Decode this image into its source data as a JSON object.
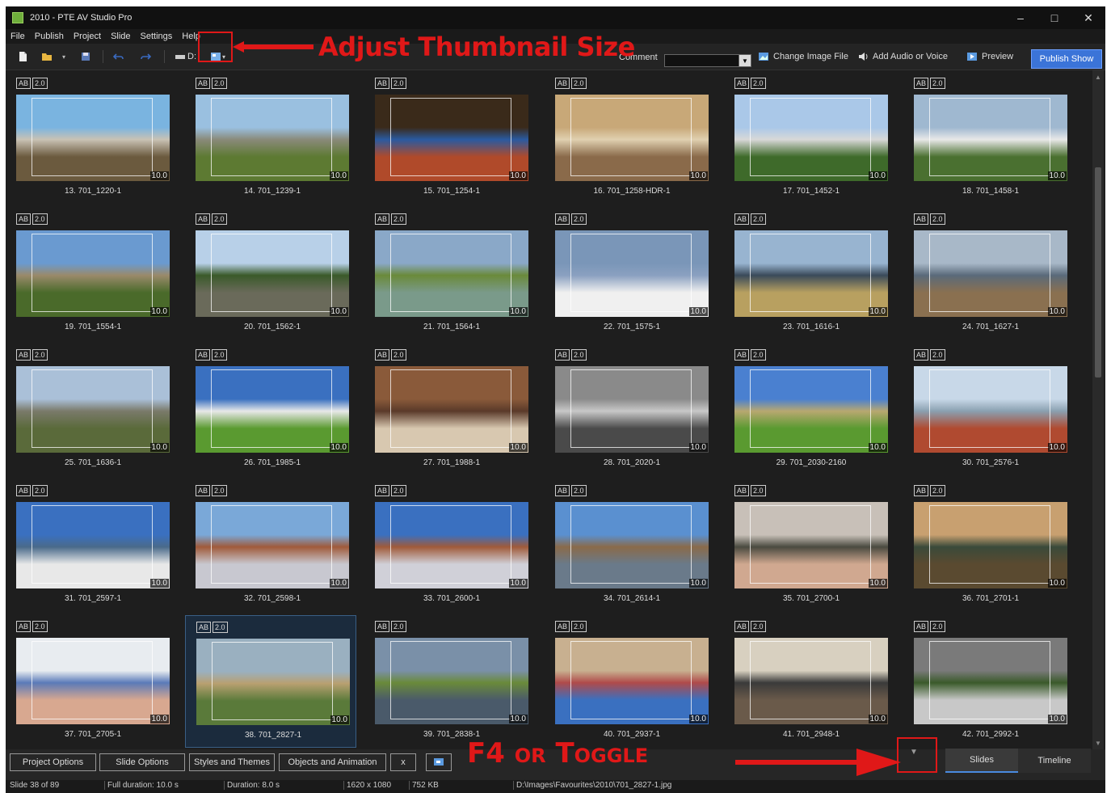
{
  "window": {
    "title": "2010 - PTE AV Studio Pro",
    "controls": [
      "–",
      "□",
      "✕"
    ]
  },
  "menu": [
    "File",
    "Publish",
    "Project",
    "Slide",
    "Settings",
    "Help"
  ],
  "toolbar": {
    "drive_label": "D:",
    "comment_label": "Comment",
    "comment_value": "",
    "change_image": "Change Image File",
    "add_audio": "Add Audio or Voice",
    "preview": "Preview",
    "publish": "Publish Show"
  },
  "annotations": {
    "top": "Adjust Thumbnail Size",
    "bottom": "F4 or Toggle",
    "color": "#e01818"
  },
  "badge_labels": [
    "AB",
    "2.0"
  ],
  "slides": [
    {
      "caption": "13. 701_1220-1",
      "dur": "10.0",
      "palette": [
        "#7ab4e0",
        "#6b5a3e",
        "#c9c2b4"
      ]
    },
    {
      "caption": "14. 701_1239-1",
      "dur": "10.0",
      "palette": [
        "#9ac0e0",
        "#5d7a32",
        "#8a8a7a"
      ]
    },
    {
      "caption": "15. 701_1254-1",
      "dur": "10.0",
      "palette": [
        "#3a2a1a",
        "#b04a2a",
        "#2a5aa0"
      ]
    },
    {
      "caption": "16. 701_1258-HDR-1",
      "dur": "10.0",
      "palette": [
        "#c8a878",
        "#8a6a4a",
        "#e0d0b0"
      ]
    },
    {
      "caption": "17. 701_1452-1",
      "dur": "10.0",
      "palette": [
        "#aac8e8",
        "#3e6a2a",
        "#d8d8d8"
      ]
    },
    {
      "caption": "18. 701_1458-1",
      "dur": "10.0",
      "palette": [
        "#9fb8d0",
        "#4a7030",
        "#e8e8e8"
      ]
    },
    {
      "caption": "19. 701_1554-1",
      "dur": "10.0",
      "palette": [
        "#6a9ad0",
        "#4a6a2a",
        "#9a8a6a"
      ]
    },
    {
      "caption": "20. 701_1562-1",
      "dur": "10.0",
      "palette": [
        "#b8d0e8",
        "#6a6a5a",
        "#3a5a2a"
      ]
    },
    {
      "caption": "21. 701_1564-1",
      "dur": "10.0",
      "palette": [
        "#8aa8c8",
        "#7a9a8a",
        "#6a8a3a"
      ]
    },
    {
      "caption": "22. 701_1575-1",
      "dur": "10.0",
      "palette": [
        "#7a96b8",
        "#f0f0f0",
        "#8aa0c0"
      ]
    },
    {
      "caption": "23. 701_1616-1",
      "dur": "10.0",
      "palette": [
        "#98b4d0",
        "#b8a060",
        "#3a4a5a"
      ]
    },
    {
      "caption": "24. 701_1627-1",
      "dur": "10.0",
      "palette": [
        "#a8b8c8",
        "#8a7050",
        "#5a6a7a"
      ]
    },
    {
      "caption": "25. 701_1636-1",
      "dur": "10.0",
      "palette": [
        "#aac0d8",
        "#5a6a3a",
        "#7a7a6a"
      ]
    },
    {
      "caption": "26. 701_1985-1",
      "dur": "10.0",
      "palette": [
        "#3a70c0",
        "#5a9a30",
        "#e8e8e8"
      ]
    },
    {
      "caption": "27. 701_1988-1",
      "dur": "10.0",
      "palette": [
        "#8a5a3a",
        "#d8c8b0",
        "#5a3a2a"
      ]
    },
    {
      "caption": "28. 701_2020-1",
      "dur": "10.0",
      "palette": [
        "#8a8a8a",
        "#4a4a4a",
        "#c8c8c8"
      ]
    },
    {
      "caption": "29. 701_2030-2160",
      "dur": "10.0",
      "palette": [
        "#4a80d0",
        "#5a9a30",
        "#b8a870"
      ]
    },
    {
      "caption": "30. 701_2576-1",
      "dur": "10.0",
      "palette": [
        "#c8d8e8",
        "#b04a30",
        "#8aa0b0"
      ]
    },
    {
      "caption": "31. 701_2597-1",
      "dur": "10.0",
      "palette": [
        "#3a70c0",
        "#e8e8e8",
        "#4a6a8a"
      ]
    },
    {
      "caption": "32. 701_2598-1",
      "dur": "10.0",
      "palette": [
        "#7aa8d8",
        "#c8c8d0",
        "#a05a3a"
      ]
    },
    {
      "caption": "33. 701_2600-1",
      "dur": "10.0",
      "palette": [
        "#3a70c0",
        "#d0d0d8",
        "#a05a3a"
      ]
    },
    {
      "caption": "34. 701_2614-1",
      "dur": "10.0",
      "palette": [
        "#5a90d0",
        "#6a7a8a",
        "#8a6a4a"
      ]
    },
    {
      "caption": "35. 701_2700-1",
      "dur": "10.0",
      "palette": [
        "#c8c0b8",
        "#d0a890",
        "#4a4a40"
      ]
    },
    {
      "caption": "36. 701_2701-1",
      "dur": "10.0",
      "palette": [
        "#c8a070",
        "#5a4a30",
        "#3a4a3a"
      ]
    },
    {
      "caption": "37. 701_2705-1",
      "dur": "10.0",
      "palette": [
        "#e8ecf0",
        "#d8a890",
        "#5a7ab8"
      ]
    },
    {
      "caption": "38. 701_2827-1",
      "dur": "10.0",
      "palette": [
        "#9ab0c0",
        "#5a7a3a",
        "#b8a070"
      ]
    },
    {
      "caption": "39. 701_2838-1",
      "dur": "10.0",
      "palette": [
        "#7a90a8",
        "#4a5a6a",
        "#6a8a3a"
      ]
    },
    {
      "caption": "40. 701_2937-1",
      "dur": "10.0",
      "palette": [
        "#c8b090",
        "#3a70c0",
        "#b04a4a"
      ]
    },
    {
      "caption": "41. 701_2948-1",
      "dur": "10.0",
      "palette": [
        "#d8d0c0",
        "#6a5a4a",
        "#3a3a3a"
      ]
    },
    {
      "caption": "42. 701_2992-1",
      "dur": "10.0",
      "palette": [
        "#7a7a7a",
        "#c8c8c8",
        "#3a5a2a"
      ]
    }
  ],
  "selected_slide_index": 25,
  "bottom_buttons": {
    "project_options": "Project Options",
    "slide_options": "Slide Options",
    "styles_themes": "Styles and Themes",
    "objects_animation": "Objects and Animation",
    "close": "x"
  },
  "tabs": {
    "slides": "Slides",
    "timeline": "Timeline"
  },
  "status": {
    "slide": "Slide 38 of 89",
    "full_duration": "Full duration: 10.0 s",
    "duration": "Duration: 8.0 s",
    "resolution": "1620 x 1080",
    "size": "752 KB",
    "path": "D:\\Images\\Favourites\\2010\\701_2827-1.jpg"
  }
}
